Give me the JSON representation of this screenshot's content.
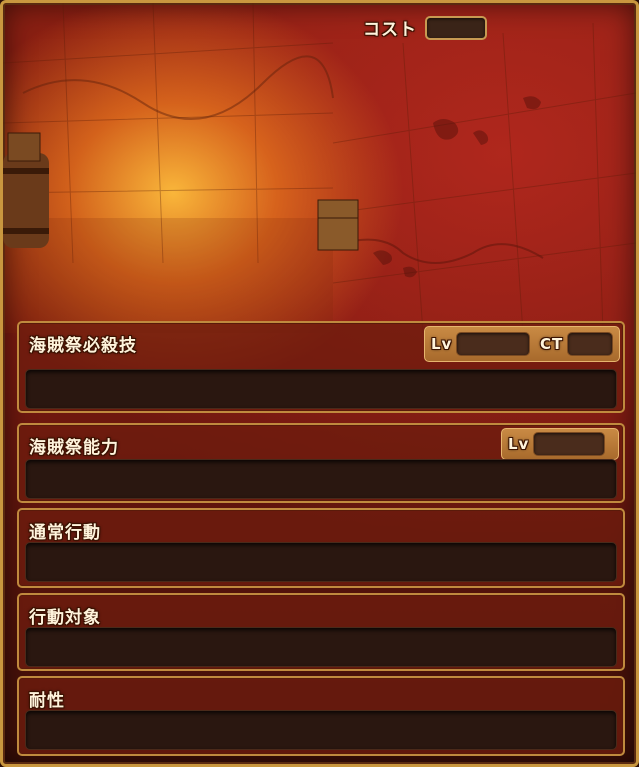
{
  "header": {
    "cost_label": "コスト",
    "cost_value": ""
  },
  "panels": {
    "special": {
      "title": "海賊祭必殺技",
      "lv_label": "Lv",
      "lv_value": "",
      "ct_label": "CT",
      "ct_value": "",
      "text": ""
    },
    "ability": {
      "title": "海賊祭能力",
      "lv_label": "Lv",
      "lv_value": "",
      "text": ""
    },
    "normal_action": {
      "title": "通常行動",
      "text": ""
    },
    "action_target": {
      "title": "行動対象",
      "text": ""
    },
    "resistance": {
      "title": "耐性",
      "text": ""
    }
  },
  "colors": {
    "frame_gold": "#c9973f",
    "panel_red": "#6e1c0e",
    "slot_dark": "#2a1710",
    "badge_tan": "#b87a38"
  }
}
